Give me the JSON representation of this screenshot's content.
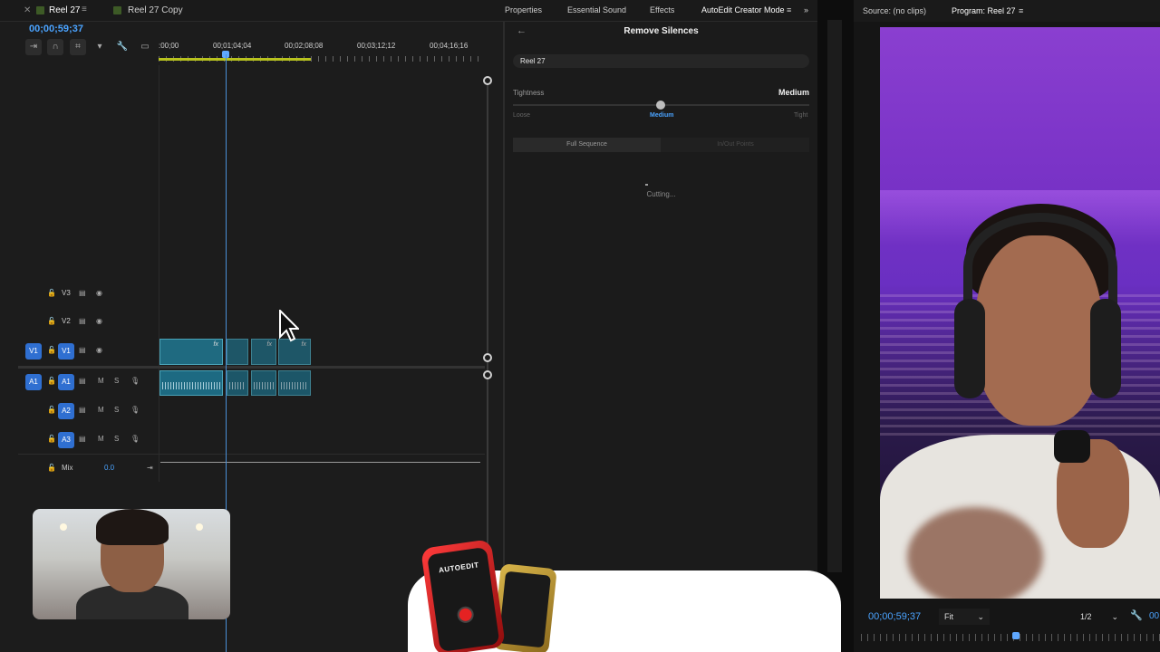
{
  "timeline": {
    "tabs": [
      {
        "label": "Reel 27",
        "active": true
      },
      {
        "label": "Reel 27 Copy",
        "active": false
      }
    ],
    "timecode": "00;00;59;37",
    "ruler_labels": [
      ":00;00",
      "00;01;04;04",
      "00;02;08;08",
      "00;03;12;12",
      "00;04;16;16"
    ],
    "tracks": {
      "v3": {
        "label": "V3"
      },
      "v2": {
        "label": "V2"
      },
      "v1": {
        "source": "V1",
        "label": "V1"
      },
      "a1": {
        "source": "A1",
        "label": "A1",
        "m": "M",
        "s": "S"
      },
      "a2": {
        "label": "A2",
        "m": "M",
        "s": "S"
      },
      "a3": {
        "label": "A3",
        "m": "M",
        "s": "S"
      },
      "mix": {
        "label": "Mix",
        "value": "0.0"
      }
    },
    "clip_fx_label": "fx"
  },
  "panel": {
    "tabs": [
      "Properties",
      "Essential Sound",
      "Effects",
      "AutoEdit Creator Mode"
    ],
    "active_tab": "AutoEdit Creator Mode",
    "title": "Remove Silences",
    "sequence": "Reel 27",
    "tightness": {
      "label": "Tightness",
      "value": "Medium",
      "min_label": "Loose",
      "mid_label": "Medium",
      "max_label": "Tight"
    },
    "scope": {
      "option_a": "Full Sequence",
      "option_b": "In/Out Points",
      "selected": "Full Sequence"
    },
    "status": "Cutting..."
  },
  "monitor": {
    "source_tab": "Source: (no clips)",
    "program_tab": "Program: Reel 27",
    "timecode": "00;00;59;37",
    "fit": "Fit",
    "resolution": "1/2",
    "right_tc": "00"
  },
  "overlay": {
    "device_logo": "AUTOEDIT"
  },
  "colors": {
    "accent_blue": "#4aa3ff",
    "track_blue": "#2f6fd1",
    "clip_teal": "#1f6a80",
    "ruler_yellow": "#b8c21e"
  },
  "icons": [
    "ripple-icon",
    "snap-magnet-icon",
    "linked-selection-icon",
    "marker-icon",
    "wrench-icon",
    "captions-icon",
    "lock-icon",
    "film-icon",
    "eye-icon",
    "mic-icon",
    "back-arrow-icon",
    "chevron-down-icon",
    "menu-icon",
    "double-chevron-icon"
  ]
}
